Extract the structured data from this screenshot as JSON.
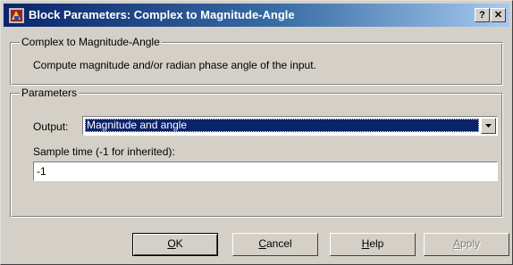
{
  "window": {
    "title": "Block Parameters: Complex to Magnitude-Angle"
  },
  "titlebar": {
    "help_glyph": "?",
    "close_glyph": "✕"
  },
  "description_group": {
    "legend": "Complex to Magnitude-Angle",
    "text": "Compute magnitude and/or radian phase angle of the input."
  },
  "parameters_group": {
    "legend": "Parameters",
    "output_label": "Output:",
    "output_value": "Magnitude and angle",
    "sample_time_label": "Sample time (-1 for inherited):",
    "sample_time_value": "-1"
  },
  "buttons": {
    "ok": {
      "mnemonic": "O",
      "rest": "K"
    },
    "cancel": {
      "mnemonic": "C",
      "rest": "ancel"
    },
    "help": {
      "mnemonic": "H",
      "rest": "elp"
    },
    "apply": {
      "mnemonic": "A",
      "rest": "pply"
    }
  }
}
